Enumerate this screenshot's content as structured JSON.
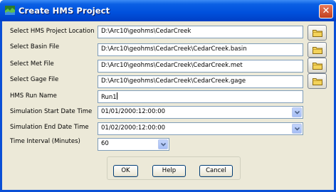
{
  "window": {
    "title": "Create HMS Project",
    "close_label": "✕"
  },
  "fields": {
    "project_location": {
      "label": "Select HMS Project Location",
      "value": "D:\\Arc10\\geohms\\CedarCreek"
    },
    "basin_file": {
      "label": "Select Basin File",
      "value": "D:\\Arc10\\geohms\\CedarCreek\\CedarCreek.basin"
    },
    "met_file": {
      "label": "Select Met File",
      "value": "D:\\Arc10\\geohms\\CedarCreek\\CedarCreek.met"
    },
    "gage_file": {
      "label": "Select Gage File",
      "value": "D:\\Arc10\\geohms\\CedarCreek\\CedarCreek.gage"
    },
    "run_name": {
      "label": "HMS Run Name",
      "value": "Run1"
    },
    "start_date": {
      "label": "Simulation Start Date Time",
      "value": "01/01/2000:12:00:00"
    },
    "end_date": {
      "label": "Simulation End Date Time",
      "value": "01/02/2000:12:00:00"
    },
    "time_interval": {
      "label": "Time Interval (Minutes)",
      "value": "60"
    }
  },
  "buttons": {
    "ok": "OK",
    "help": "Help",
    "cancel": "Cancel"
  },
  "icons": {
    "app": "hms-app-icon",
    "browse": "folder-icon",
    "dropdown": "chevron-down-icon"
  },
  "colors": {
    "titlebar": "#0050dc",
    "dialog_bg": "#ece9d8",
    "close": "#c1401f"
  }
}
